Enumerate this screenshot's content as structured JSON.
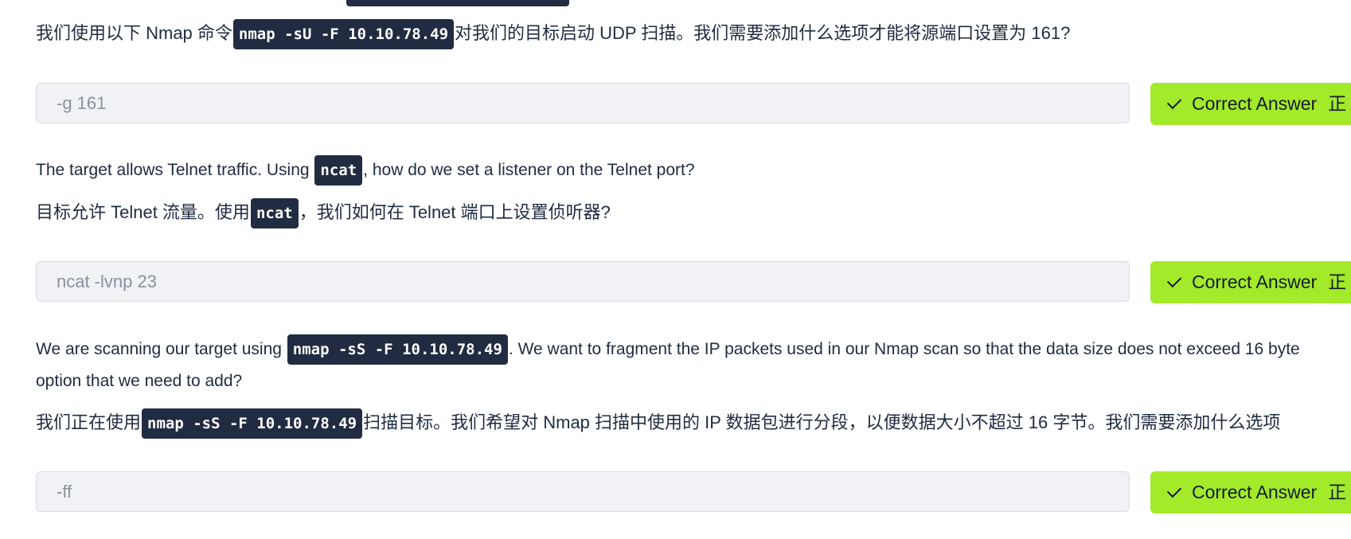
{
  "q1": {
    "zh_prefix": "我们使用以下 Nmap 命令",
    "code": "nmap -sU -F 10.10.78.49",
    "zh_suffix": "对我们的目标启动 UDP 扫描。我们需要添加什么选项才能将源端口设置为 161?",
    "answer": "-g 161",
    "button_label": "Correct Answer",
    "button_suffix": "正"
  },
  "q2": {
    "en_prefix": "The target allows Telnet traffic. Using ",
    "en_code": "ncat",
    "en_suffix": ", how do we set a listener on the Telnet port?",
    "zh_prefix": "目标允许 Telnet 流量。使用",
    "zh_code": "ncat",
    "zh_suffix": "，我们如何在 Telnet 端口上设置侦听器?",
    "answer": "ncat -lvnp 23",
    "button_label": "Correct Answer",
    "button_suffix": "正"
  },
  "q3": {
    "en_prefix": "We are scanning our target using ",
    "en_code": "nmap -sS -F 10.10.78.49",
    "en_suffix": ". We want to fragment the IP packets used in our Nmap scan so that the data size does not exceed 16 byte",
    "en_line2": "option that we need to add?",
    "zh_prefix": "我们正在使用",
    "zh_code": "nmap -sS -F 10.10.78.49",
    "zh_suffix": "扫描目标。我们希望对 Nmap 扫描中使用的 IP 数据包进行分段，以便数据大小不超过 16 字节。我们需要添加什么选项",
    "answer": "-ff",
    "button_label": "Correct Answer",
    "button_suffix": "正"
  }
}
